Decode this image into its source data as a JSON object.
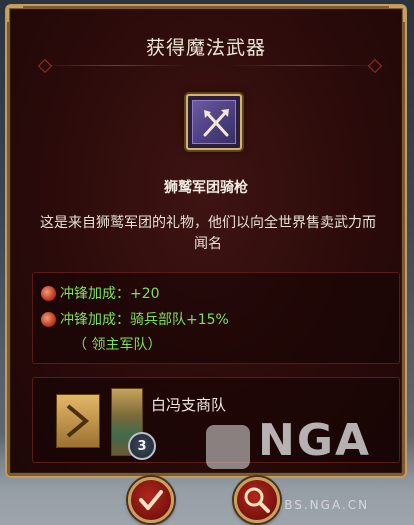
{
  "dialog": {
    "title": "获得魔法武器",
    "item_name": "狮鹫军团骑枪",
    "description": "这是来自狮鹫军团的礼物，他们以向全世界售卖武力而闻名",
    "item_icon": "crossed-weapons-icon"
  },
  "stats": [
    {
      "label": "冲锋加成：+20"
    },
    {
      "label": "冲锋加成：骑兵部队+15%"
    }
  ],
  "stat_note": "（  领主军队）",
  "owner": {
    "name": "白冯支商队",
    "rank": "3"
  },
  "buttons": {
    "confirm_icon": "checkmark-icon",
    "zoom_icon": "magnify-icon"
  },
  "watermark": {
    "logo": "NGA",
    "url": "BBS.NGA.CN"
  },
  "colors": {
    "panel_bg": "#2b0b0a",
    "frame_gold": "#c79a5a",
    "stat_green": "#7ee05a",
    "button_red": "#9a1b14"
  }
}
